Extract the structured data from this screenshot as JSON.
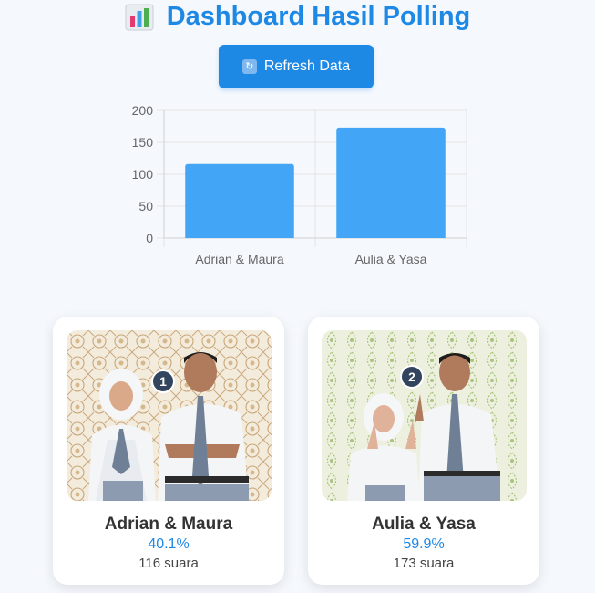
{
  "header": {
    "title": "Dashboard Hasil Polling",
    "icon": "bar-chart-icon"
  },
  "toolbar": {
    "refresh_label": "Refresh Data",
    "refresh_icon": "refresh-icon"
  },
  "colors": {
    "primary": "#1e88e5",
    "bar": "#42a5f5"
  },
  "chart_data": {
    "type": "bar",
    "categories": [
      "Adrian & Maura",
      "Aulia & Yasa"
    ],
    "values": [
      116,
      173
    ],
    "ylim": [
      0,
      200
    ],
    "yticks": [
      0,
      50,
      100,
      150,
      200
    ],
    "grid": true,
    "legend": "none"
  },
  "candidates": [
    {
      "number": "1",
      "name": "Adrian & Maura",
      "percent": "40.1%",
      "votes": "116 suara"
    },
    {
      "number": "2",
      "name": "Aulia & Yasa",
      "percent": "59.9%",
      "votes": "173 suara"
    }
  ]
}
